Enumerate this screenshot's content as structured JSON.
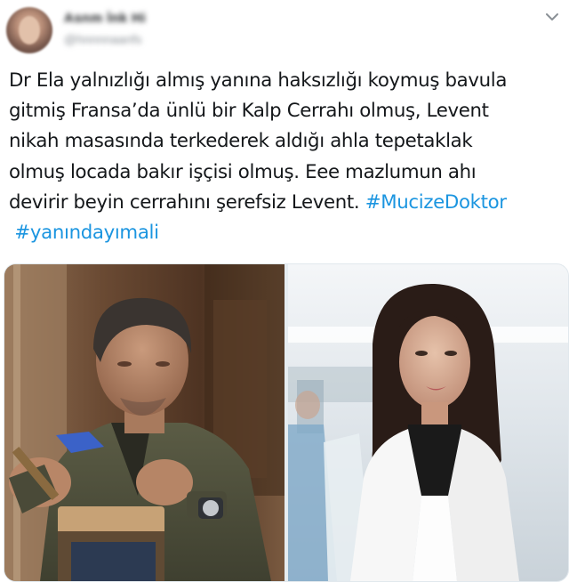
{
  "author": {
    "name": "Asnm İnk Hi",
    "handle": "@hnnnnaanfs"
  },
  "tweet": {
    "lines": [
      {
        "text": "Dr Ela yalnızlığı almış yanına haksızlığı koymuş bavula"
      },
      {
        "text": "gitmiş Fransa’da ünlü bir Kalp Cerrahı olmuş, Levent"
      },
      {
        "text": "nikah masasında terkederek aldığı ahla tepetaklak"
      },
      {
        "text": "olmuş locada bakır işçisi olmuş. Eee mazlumun ahı"
      },
      {
        "text": "devirir beyin cerrahını şerefsiz Levent. ",
        "hashtag": "#MucizeDoktor"
      },
      {
        "text": "",
        "hashtag": "#yanındayımali"
      }
    ]
  },
  "media": {
    "left_photo": {
      "label": "man-hammering-copper-photo"
    },
    "right_photo": {
      "label": "woman-in-white-coat-hospital-photo"
    }
  },
  "icons": {
    "more": "chevron-down-icon"
  },
  "colors": {
    "text": "#14171a",
    "hashtag": "#1b95e0",
    "border": "#e1e8ed"
  }
}
